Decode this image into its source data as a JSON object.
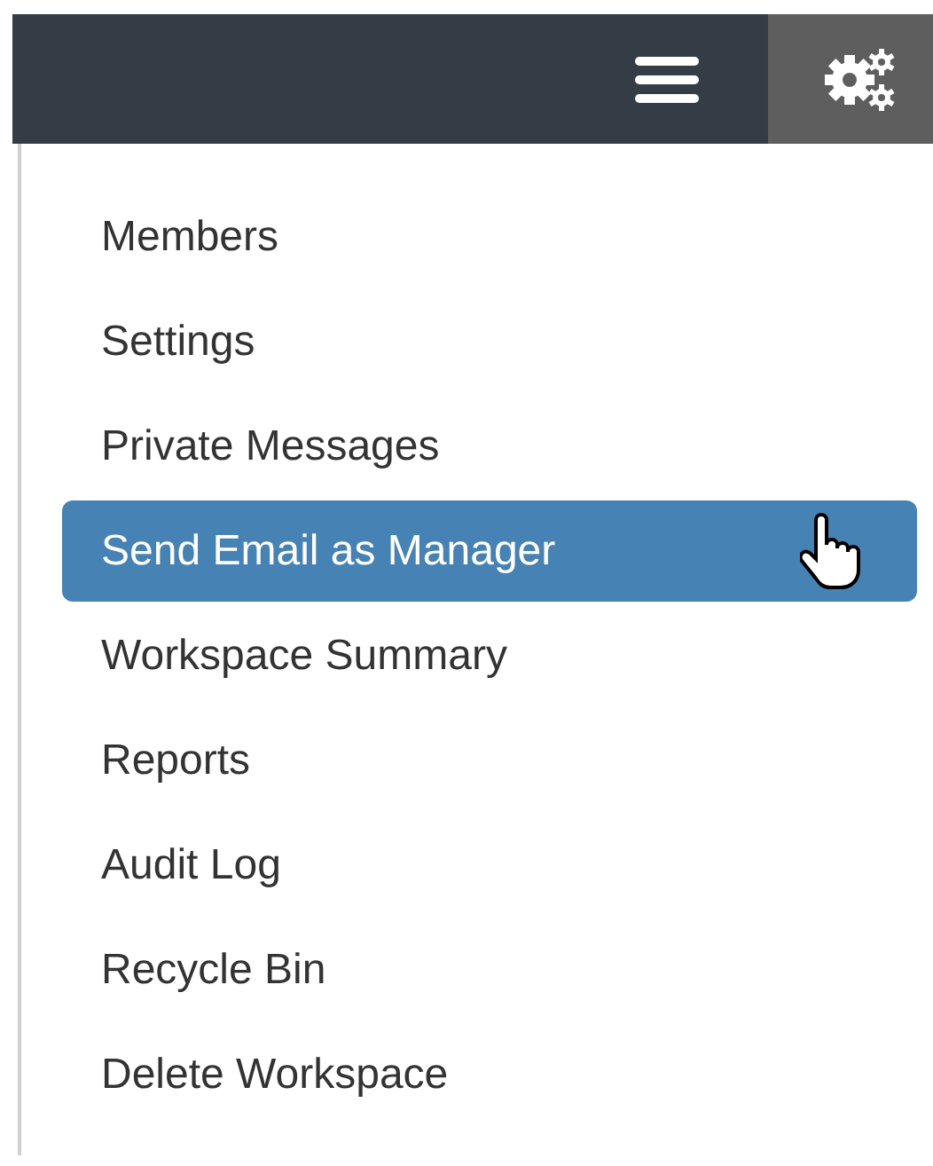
{
  "menu": {
    "items": [
      {
        "label": "Members",
        "selected": false
      },
      {
        "label": "Settings",
        "selected": false
      },
      {
        "label": "Private Messages",
        "selected": false
      },
      {
        "label": "Send Email as Manager",
        "selected": true
      },
      {
        "label": "Workspace Summary",
        "selected": false
      },
      {
        "label": "Reports",
        "selected": false
      },
      {
        "label": "Audit Log",
        "selected": false
      },
      {
        "label": "Recycle Bin",
        "selected": false
      },
      {
        "label": "Delete Workspace",
        "selected": false
      }
    ]
  }
}
